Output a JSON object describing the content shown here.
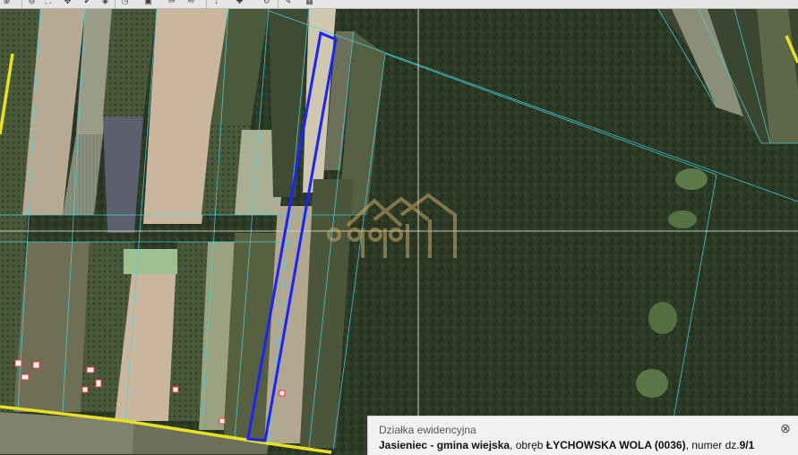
{
  "toolbar": {
    "icons": [
      "zoom-in-icon",
      "zoom-out-icon",
      "zoom-extent-icon",
      "pan-icon",
      "identify-icon",
      "select-icon",
      "measure-icon",
      "layers-icon",
      "print-icon",
      "back-icon",
      "forward-icon",
      "info-icon",
      "legend-icon",
      "edit-icon",
      "color-palette-icon"
    ],
    "glyphs": [
      "⊕",
      "⊖",
      "⛶",
      "✥",
      "✔",
      "◈",
      "◷",
      "▣",
      "⇦",
      "⇨",
      "↓",
      "✚",
      "↻",
      "✎",
      "▦"
    ]
  },
  "map": {
    "parcel_outline_color": "#1a22ff",
    "boundary_color": "#e8e020",
    "cadastral_line_color": "#43d6e6",
    "crosshair_color": "#d9d6c0",
    "watermark": "logo-house-icon"
  },
  "info_panel": {
    "title": "Działka ewidencyjna",
    "gmina": "Jasieniec - gmina wiejska",
    "obreb_prefix": ", obręb ",
    "obreb": "ŁYCHOWSKA WOLA (0036)",
    "numer_prefix": ", numer dz.",
    "numer": "9/1",
    "close_glyph": "⊗"
  }
}
